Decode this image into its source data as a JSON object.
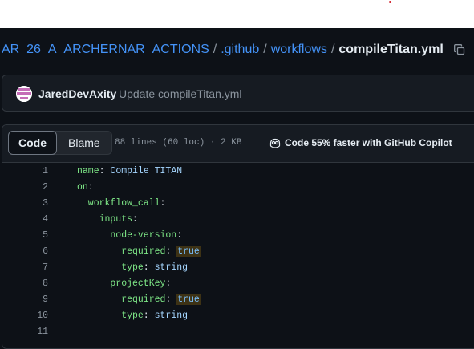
{
  "breadcrumb": {
    "repo": "AR_26_A_ARCHERNAR_ACTIONS",
    "github_dir": ".github",
    "workflows_dir": "workflows",
    "file": "compileTitan.yml",
    "separator": "/"
  },
  "commit": {
    "author": "JaredDevAxity",
    "message": "Update compileTitan.yml"
  },
  "file_header": {
    "tabs": [
      "Code",
      "Blame"
    ],
    "active_tab": "Code",
    "meta": "88 lines (60 loc) · 2 KB",
    "copilot_text": "Code 55% faster with GitHub Copilot"
  },
  "code_lines": [
    {
      "n": "1",
      "key": "name",
      "value": "Compile TITAN"
    },
    {
      "n": "2",
      "key": "on",
      "value": ""
    },
    {
      "n": "3",
      "key": "workflow_call",
      "value": ""
    },
    {
      "n": "4",
      "key": "inputs",
      "value": ""
    },
    {
      "n": "5",
      "key": "node-version",
      "value": ""
    },
    {
      "n": "6",
      "key": "required",
      "value": "true"
    },
    {
      "n": "7",
      "key": "type",
      "value": "string"
    },
    {
      "n": "8",
      "key": "projectKey",
      "value": ""
    },
    {
      "n": "9",
      "key": "required",
      "value": "true"
    },
    {
      "n": "10",
      "key": "type",
      "value": "string"
    },
    {
      "n": "11",
      "key": "",
      "value": ""
    }
  ],
  "colors": {
    "link": "#4493f8",
    "yaml_key": "#7ee787",
    "yaml_string": "#a5d6ff",
    "yaml_bool": "#79c0ff",
    "search_highlight": "#3d3215"
  }
}
